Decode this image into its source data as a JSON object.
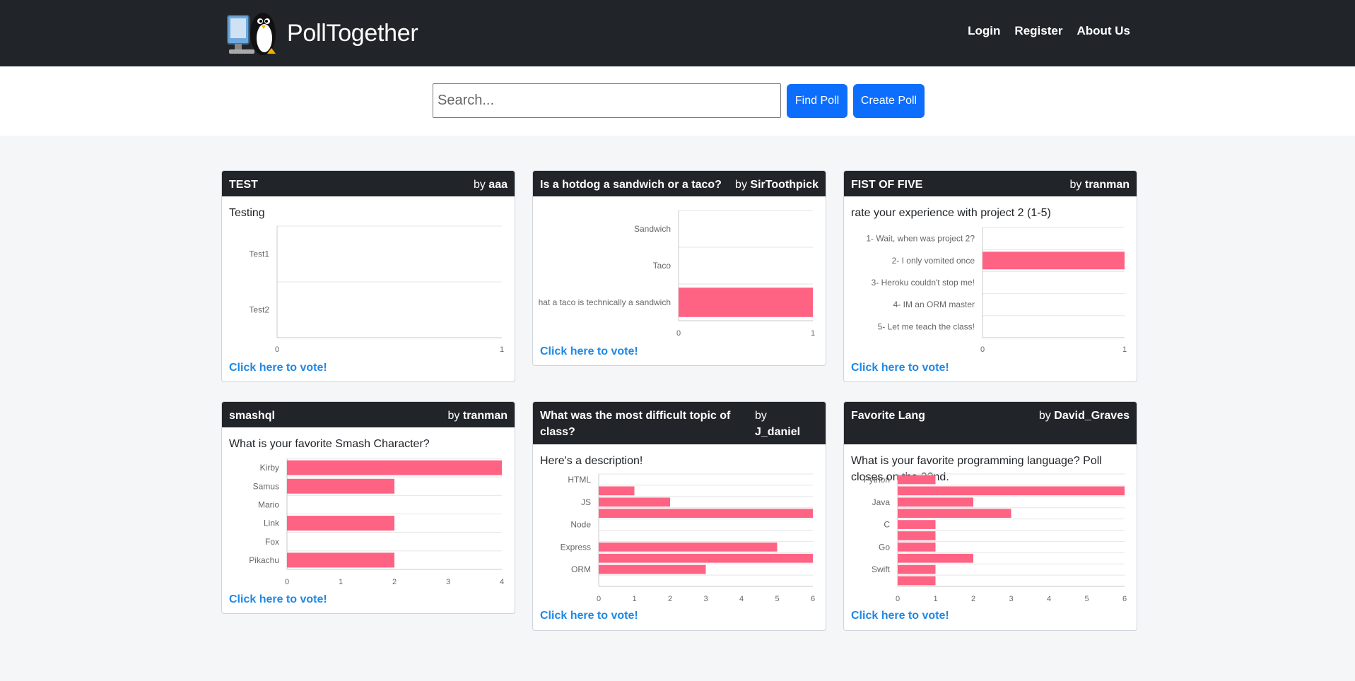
{
  "nav": {
    "brand": "PollTogether",
    "links": [
      "Login",
      "Register",
      "About Us"
    ]
  },
  "search": {
    "placeholder": "Search...",
    "find_label": "Find Poll",
    "create_label": "Create Poll"
  },
  "colors": {
    "bar": "#ff6384",
    "bar_border": "#ff6384",
    "header": "#212529",
    "link": "#1e88e5",
    "button": "#0d6efd"
  },
  "vote_label": "Click here to vote!",
  "by_label": "by",
  "polls": [
    {
      "title": "TEST",
      "author": "aaa",
      "description": "Testing",
      "chart_data": {
        "type": "bar",
        "orientation": "horizontal",
        "categories": [
          "Test1",
          "Test2"
        ],
        "values": [
          0,
          0
        ],
        "xlim": [
          0,
          1
        ],
        "xticks": [
          0,
          1
        ],
        "grid": true
      }
    },
    {
      "title": "Is a hotdog a sandwich or a taco?",
      "author": "SirToothpick",
      "description": "",
      "chart_data": {
        "type": "bar",
        "orientation": "horizontal",
        "categories": [
          "Sandwich",
          "Taco",
          "hat a taco is technically a sandwich"
        ],
        "values": [
          0,
          0,
          1
        ],
        "xlim": [
          0,
          1
        ],
        "xticks": [
          0,
          1
        ],
        "grid": true
      }
    },
    {
      "title": "FIST OF FIVE",
      "author": "tranman",
      "description": "rate your experience with project 2 (1-5)",
      "chart_data": {
        "type": "bar",
        "orientation": "horizontal",
        "categories": [
          "1- Wait, when was project 2?",
          "2- I only vomited once",
          "3- Heroku couldn't stop me!",
          "4- IM an ORM master",
          "5- Let me teach the class!"
        ],
        "values": [
          0,
          1,
          0,
          0,
          0
        ],
        "xlim": [
          0,
          1
        ],
        "xticks": [
          0,
          1
        ],
        "grid": true
      }
    },
    {
      "title": "smashql",
      "author": "tranman",
      "description": "What is your favorite Smash Character?",
      "chart_data": {
        "type": "bar",
        "orientation": "horizontal",
        "categories": [
          "Kirby",
          "Samus",
          "Mario",
          "Link",
          "Fox",
          "Pikachu"
        ],
        "values": [
          4,
          2,
          0,
          2,
          0,
          2
        ],
        "xlim": [
          0,
          4
        ],
        "xticks": [
          0,
          1,
          2,
          3,
          4
        ],
        "grid": true
      }
    },
    {
      "title": "What was the most difficult topic of class?",
      "author": "J_daniel",
      "description": "Here's a description!",
      "chart_data": {
        "type": "bar",
        "orientation": "horizontal",
        "categories": [
          "HTML",
          "",
          "JS",
          "",
          "Node",
          "",
          "Express",
          "",
          "ORM",
          ""
        ],
        "values": [
          0,
          1,
          2,
          6,
          0,
          0,
          5,
          6,
          3,
          0
        ],
        "shown_labels": [
          "HTML",
          "JS",
          "Node",
          "Express",
          "ORM"
        ],
        "xlim": [
          0,
          6
        ],
        "xticks": [
          0,
          1,
          2,
          3,
          4,
          5,
          6
        ],
        "grid": true
      }
    },
    {
      "title": "Favorite Lang",
      "author": "David_Graves",
      "description": "What is your favorite programming language? Poll closes on the 22nd.",
      "chart_data": {
        "type": "bar",
        "orientation": "horizontal",
        "categories": [
          "Python",
          "",
          "Java",
          "",
          "C",
          "",
          "Go",
          "",
          "Swift",
          ""
        ],
        "values": [
          1,
          6,
          2,
          3,
          1,
          1,
          1,
          2,
          1,
          1
        ],
        "shown_labels": [
          "Python",
          "Java",
          "C",
          "Go",
          "Swift"
        ],
        "xlim": [
          0,
          6
        ],
        "xticks": [
          0,
          1,
          2,
          3,
          4,
          5,
          6
        ],
        "grid": true
      }
    }
  ]
}
